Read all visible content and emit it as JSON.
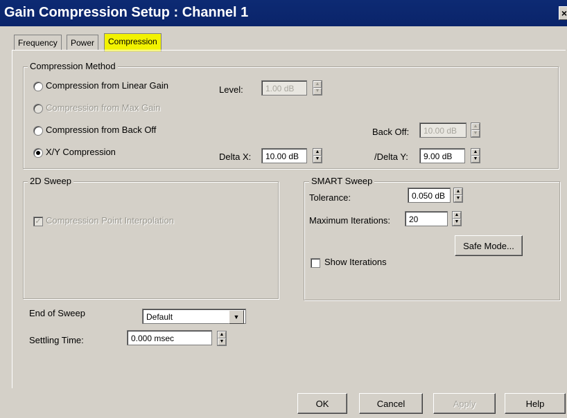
{
  "window": {
    "title": "Gain Compression Setup : Channel 1",
    "close_label": "×"
  },
  "tabs": [
    {
      "label": "Frequency",
      "active": false
    },
    {
      "label": "Power",
      "active": false
    },
    {
      "label": "Compression",
      "active": true
    }
  ],
  "compression_method": {
    "legend": "Compression Method",
    "options": [
      {
        "label": "Compression from Linear Gain",
        "selected": false,
        "enabled": true
      },
      {
        "label": "Compression from Max Gain",
        "selected": false,
        "enabled": false
      },
      {
        "label": "Compression from Back Off",
        "selected": false,
        "enabled": true
      },
      {
        "label": "X/Y Compression",
        "selected": true,
        "enabled": true
      }
    ],
    "level_label": "Level:",
    "level_value": "1.00 dB",
    "backoff_label": "Back Off:",
    "backoff_value": "10.00 dB",
    "deltax_label": "Delta X:",
    "deltax_value": "10.00 dB",
    "deltay_label": "/Delta Y:",
    "deltay_value": "9.00 dB"
  },
  "sweep_2d": {
    "legend": "2D Sweep",
    "interpolation_label": "Compression Point Interpolation",
    "interpolation_checked": true
  },
  "smart_sweep": {
    "legend": "SMART Sweep",
    "tolerance_label": "Tolerance:",
    "tolerance_value": "0.050 dB",
    "max_iter_label": "Maximum Iterations:",
    "max_iter_value": "20",
    "safe_mode_label": "Safe Mode...",
    "show_iter_label": "Show Iterations",
    "show_iter_checked": false
  },
  "end_of_sweep": {
    "label": "End of Sweep",
    "value": "Default"
  },
  "settling_time": {
    "label": "Settling Time:",
    "value": "0.000 msec"
  },
  "footer": {
    "ok": "OK",
    "cancel": "Cancel",
    "apply": "Apply",
    "help": "Help"
  },
  "colors": {
    "title_bar": "#0a246a",
    "active_tab": "#f2f200",
    "dialog_bg": "#d4d0c8"
  },
  "icons": {
    "spin_up": "▲",
    "spin_down": "▼",
    "dropdown": "▼",
    "check": "✓"
  }
}
